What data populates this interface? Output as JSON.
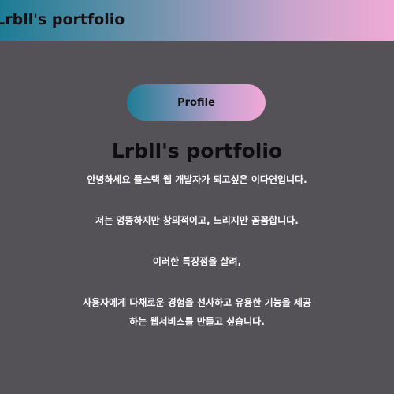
{
  "header": {
    "title": "Lrbll's portfolio"
  },
  "profile_button": {
    "label": "Profile"
  },
  "main": {
    "title": "Lrbll's portfolio",
    "paragraphs": [
      "안녕하세요 풀스택 웹 개발자가 되고싶은 이다연입니다.",
      "저는 엉뚱하지만 창의적이고, 느리지만 꼼꼼합니다.",
      "이러한 특장점을 살려,",
      "사용자에게 다채로운 경험을 선사하고 유용한 기능을 제공하는 웹서비스를 만들고 싶습니다."
    ]
  },
  "colors": {
    "background": "#545157",
    "gradient_start": "#1d7c95",
    "gradient_end": "#efaad6",
    "title_text": "#0d0c10",
    "body_text": "#ffffff"
  }
}
